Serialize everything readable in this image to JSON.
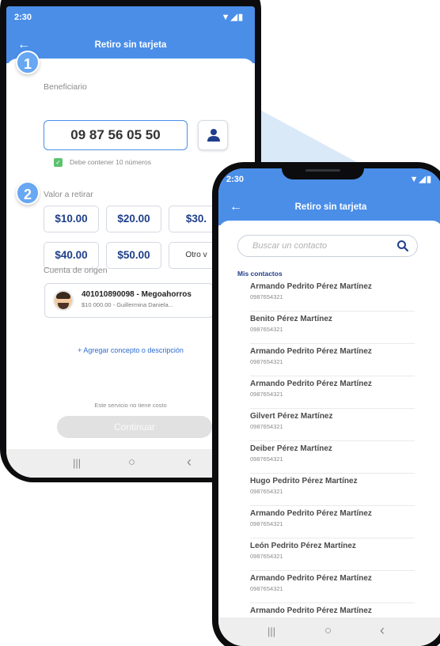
{
  "status": {
    "time_left": "2:30",
    "time_right": "2:30"
  },
  "left_phone": {
    "title": "Retiro sin tarjeta",
    "step_1": "1",
    "step_2": "2",
    "beneficiary_label": "Beneficiario",
    "beneficiary_value": "09 87 56 05 50",
    "validation_text": "Debe contener 10 números",
    "amount_label": "Valor a retirar",
    "amounts": [
      "$10.00",
      "$20.00",
      "$30.",
      "$40.00",
      "$50.00",
      "Otro v"
    ],
    "origin_label": "Cuenta de origen",
    "account_name": "401010890098 - Megoahorros",
    "account_sub": "$10 000.00 - Guillermina Daniela...",
    "add_concept": "+ Agregar concepto o descripción",
    "service_note": "Este servicio no tiene costo",
    "continue_label": "Continuar"
  },
  "right_phone": {
    "title": "Retiro sin tarjeta",
    "search_placeholder": "Buscar un contacto",
    "section_title": "Mis contactos",
    "contacts": [
      {
        "name": "Armando Pedrito Pérez Martínez",
        "phone": "0987654321"
      },
      {
        "name": "Benito Pérez Martínez",
        "phone": "0987654321"
      },
      {
        "name": "Armando Pedrito Pérez Martínez",
        "phone": "0987654321"
      },
      {
        "name": "Armando Pedrito Pérez Martínez",
        "phone": "0987654321"
      },
      {
        "name": "Gilvert Pérez Martínez",
        "phone": "0987654321"
      },
      {
        "name": "Deiber Pérez Martínez",
        "phone": "0987654321"
      },
      {
        "name": "Hugo Pedrito Pérez Martínez",
        "phone": "0987654321"
      },
      {
        "name": "Armando Pedrito Pérez Martínez",
        "phone": "0987654321"
      },
      {
        "name": "León Pedrito Pérez Martínez",
        "phone": "0987654321"
      },
      {
        "name": "Armando Pedrito Pérez Martínez",
        "phone": "0987654321"
      },
      {
        "name": "Armando Pedrito Pérez Martínez",
        "phone": ""
      }
    ]
  },
  "nav": {
    "recents": "|||",
    "home": "○",
    "back": "‹"
  },
  "colors": {
    "primary": "#4a8ee8",
    "accent_dark": "#1f3f8a",
    "success": "#5cc26e",
    "connector": "#cfe2f6"
  }
}
